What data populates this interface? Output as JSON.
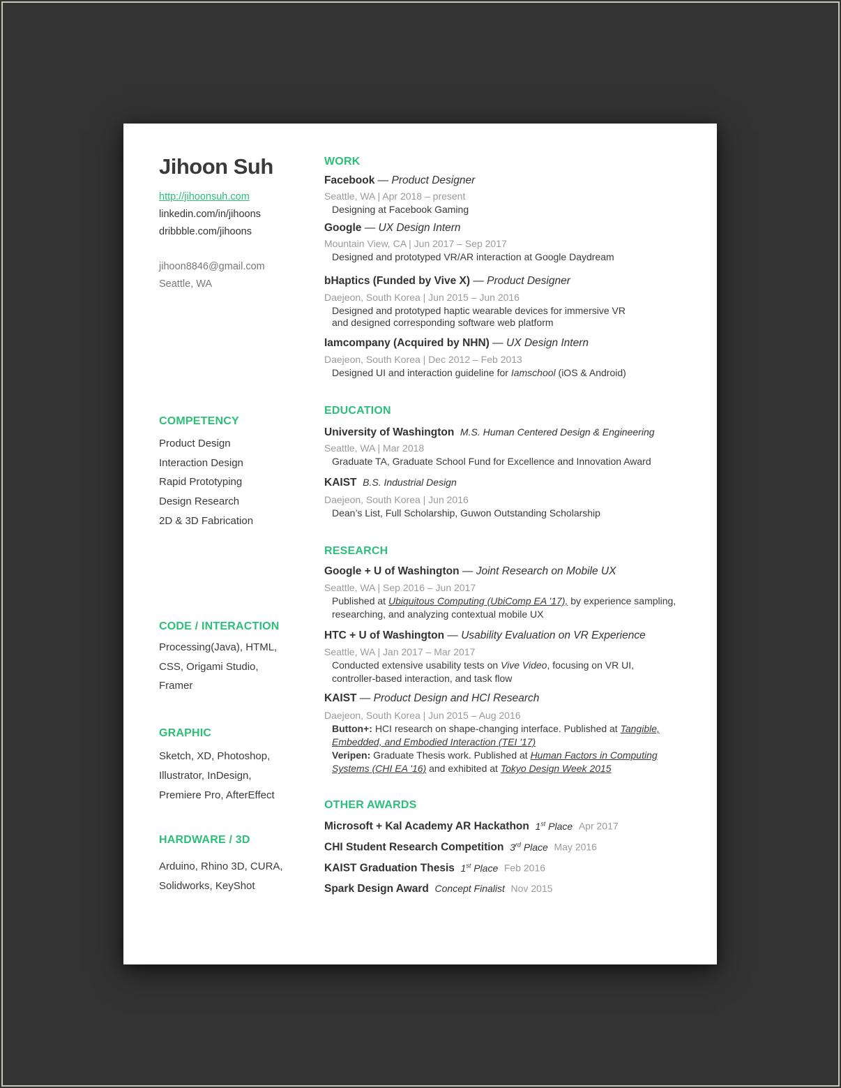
{
  "profile": {
    "name": "Jihoon Suh",
    "website": "http://jihoonsuh.com",
    "linkedin": "linkedin.com/in/jihoons",
    "dribbble": "dribbble.com/jihoons",
    "email": "jihoon8846@gmail.com",
    "location": "Seattle, WA"
  },
  "accent_color": "#2dbe7a",
  "sidebar": {
    "competency": {
      "title": "COMPETENCY",
      "items": [
        "Product Design",
        "Interaction Design",
        "Rapid Prototyping",
        "Design Research",
        "2D & 3D Fabrication"
      ]
    },
    "code": {
      "title": "CODE / INTERACTION",
      "lines": [
        "Processing(Java), HTML,",
        "CSS, Origami Studio,",
        "Framer"
      ]
    },
    "graphic": {
      "title": "GRAPHIC",
      "lines": [
        "Sketch, XD, Photoshop,",
        "Illustrator, InDesign,",
        "Premiere Pro, AfterEffect"
      ]
    },
    "hardware": {
      "title": "HARDWARE / 3D",
      "lines": [
        "Arduino, Rhino 3D, CURA,",
        "Solidworks, KeyShot"
      ]
    }
  },
  "work": {
    "title": "WORK",
    "entries": [
      {
        "org": "Facebook",
        "sep": " — ",
        "role": "Product Designer",
        "meta": "Seattle, WA  |  Apr 2018 – present",
        "desc": [
          "Designing at Facebook Gaming"
        ]
      },
      {
        "org": "Google",
        "sep": " — ",
        "role": "UX Design Intern",
        "meta": "Mountain View, CA  |  Jun 2017 – Sep 2017",
        "desc": [
          "Designed and prototyped VR/AR interaction at Google Daydream"
        ]
      },
      {
        "org": "bHaptics (Funded by Vive X)",
        "sep": " — ",
        "role": "Product Designer",
        "meta": "Daejeon, South Korea  |  Jun 2015 – Jun 2016",
        "desc": [
          "Designed and prototyped haptic wearable devices for immersive VR",
          "and designed corresponding software web platform"
        ]
      },
      {
        "org": "Iamcompany (Acquired by NHN)",
        "sep": "— ",
        "role": "UX Design Intern",
        "meta": "Daejeon, South Korea  |  Dec 2012 – Feb 2013",
        "desc_pre": "Designed UI and interaction guideline for ",
        "desc_em": "Iamschool",
        "desc_post": " (iOS & Android)"
      }
    ]
  },
  "education": {
    "title": "EDUCATION",
    "entries": [
      {
        "org": "University of Washington",
        "degree": "M.S. Human Centered Design & Engineering",
        "meta": "Seattle, WA  |  Mar 2018",
        "desc": "Graduate TA, Graduate School Fund for Excellence and Innovation Award"
      },
      {
        "org": "KAIST",
        "degree": "B.S. Industrial Design",
        "meta": "Daejeon, South Korea  |  Jun 2016",
        "desc": "Dean’s List, Full Scholarship, Guwon Outstanding Scholarship"
      }
    ]
  },
  "research": {
    "title": "RESEARCH",
    "entries": [
      {
        "org": "Google + U of Washington",
        "sep": " — ",
        "role": "Joint Research on Mobile UX",
        "meta": "Seattle, WA  |   Sep 2016 – Jun 2017",
        "l1_pre": "Published at ",
        "l1_link": "Ubiquitous Computing (UbiComp EA '17),",
        "l1_post": " by experience sampling,",
        "l2": "researching, and analyzing contextual mobile UX"
      },
      {
        "org": "HTC + U of Washington",
        "sep": " — ",
        "role": "Usability Evaluation on VR Experience",
        "meta": "Seattle, WA  |  Jan 2017 – Mar 2017",
        "l1_pre": "Conducted extensive usability tests on ",
        "l1_em": "Vive Video",
        "l1_post": ", focusing on VR UI,",
        "l2": "controller-based interaction, and task flow"
      },
      {
        "org": "KAIST",
        "sep": " — ",
        "role": "Product Design and HCI Research",
        "meta": "Daejeon, South Korea  |  Jun 2015 – Aug 2016",
        "b1_label": "Button+:",
        "b1_text": " HCI research on shape-changing interface. Published at ",
        "b1_link_a": "Tangible,",
        "b1_link_b": "Embedded, and Embodied Interaction (TEI '17)",
        "b2_label": "Veripen:",
        "b2_text": " Graduate Thesis work. Published at ",
        "b2_link_a": "Human Factors in Computing",
        "b2_link_b": "Systems (CHI EA '16)",
        "b2_mid": " and exhibited at ",
        "b2_link_c": "Tokyo Design Week 2015"
      }
    ]
  },
  "awards": {
    "title": "OTHER AWARDS",
    "entries": [
      {
        "name": "Microsoft + Kal Academy AR Hackathon",
        "rank_num": "1",
        "rank_sup": "st",
        "rank_text": " Place",
        "date": "Apr 2017"
      },
      {
        "name": "CHI Student Research Competition",
        "rank_num": "3",
        "rank_sup": "rd",
        "rank_text": " Place",
        "date": "May 2016"
      },
      {
        "name": "KAIST Graduation Thesis",
        "rank_num": "1",
        "rank_sup": "st",
        "rank_text": " Place",
        "date": "Feb 2016"
      },
      {
        "name": "Spark Design Award",
        "rank_num": "",
        "rank_sup": "",
        "rank_text": "Concept Finalist",
        "date": "Nov 2015"
      }
    ]
  }
}
